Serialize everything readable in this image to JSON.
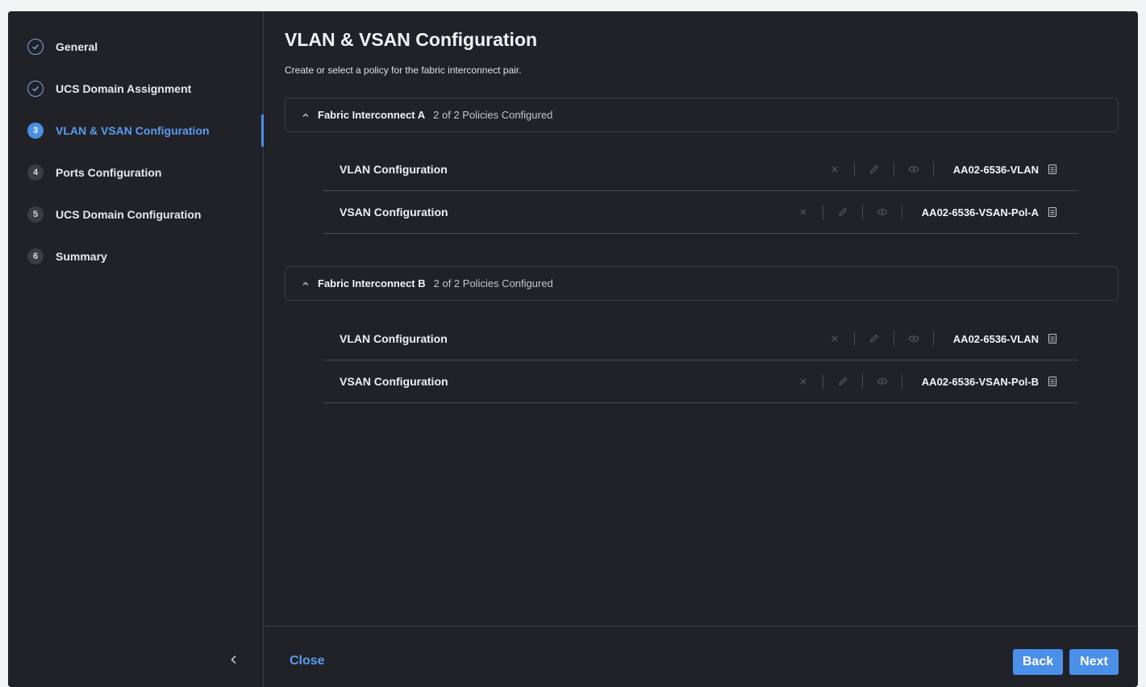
{
  "sidebar": {
    "steps": [
      {
        "marker": "",
        "label": "General",
        "state": "done"
      },
      {
        "marker": "",
        "label": "UCS Domain Assignment",
        "state": "done"
      },
      {
        "marker": "3",
        "label": "VLAN & VSAN Configuration",
        "state": "active"
      },
      {
        "marker": "4",
        "label": "Ports Configuration",
        "state": "todo"
      },
      {
        "marker": "5",
        "label": "UCS Domain Configuration",
        "state": "todo"
      },
      {
        "marker": "6",
        "label": "Summary",
        "state": "todo"
      }
    ],
    "collapse_icon": "chevron-left-icon"
  },
  "main": {
    "title": "VLAN & VSAN Configuration",
    "subtitle": "Create or select a policy for the fabric interconnect pair.",
    "sections": [
      {
        "title": "Fabric Interconnect A",
        "status": "2 of 2 Policies Configured",
        "rows": [
          {
            "label": "VLAN Configuration",
            "policy": "AA02-6536-VLAN"
          },
          {
            "label": "VSAN Configuration",
            "policy": "AA02-6536-VSAN-Pol-A"
          }
        ]
      },
      {
        "title": "Fabric Interconnect B",
        "status": "2 of 2 Policies Configured",
        "rows": [
          {
            "label": "VLAN Configuration",
            "policy": "AA02-6536-VLAN"
          },
          {
            "label": "VSAN Configuration",
            "policy": "AA02-6536-VSAN-Pol-B"
          }
        ]
      }
    ]
  },
  "footer": {
    "close_label": "Close",
    "back_label": "Back",
    "next_label": "Next"
  },
  "colors": {
    "accent": "#4a8fe8",
    "background": "#202227",
    "divider": "#4a4d55"
  }
}
